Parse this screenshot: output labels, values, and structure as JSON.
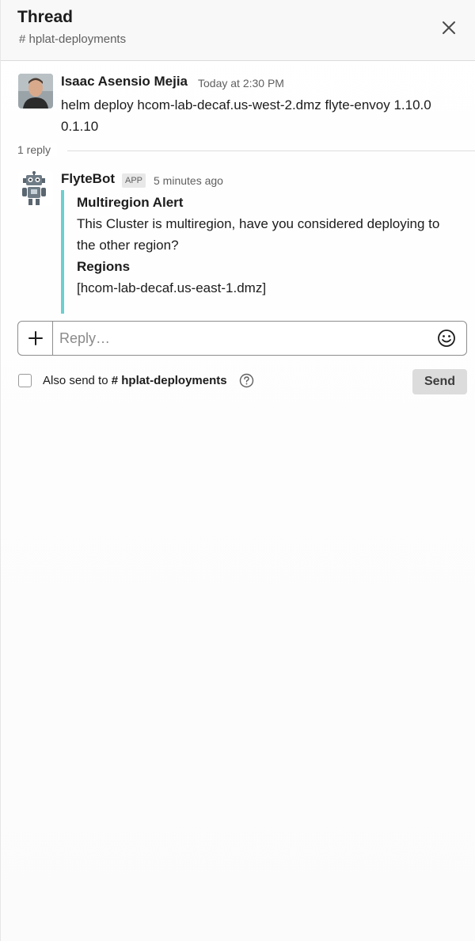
{
  "header": {
    "title": "Thread",
    "channel": "# hplat-deployments"
  },
  "parent_message": {
    "author": "Isaac Asensio Mejia",
    "time": "Today at 2:30 PM",
    "text": "helm deploy hcom-lab-decaf.us-west-2.dmz flyte-envoy 1.10.0 0.1.10"
  },
  "replies": {
    "count_label": "1 reply"
  },
  "reply_message": {
    "author": "FlyteBot",
    "badge": "APP",
    "time": "5 minutes ago",
    "attachment": {
      "accent_color": "#6ecfcf",
      "title": "Multiregion Alert",
      "text": "This Cluster is multiregion, have you considered deploying to the other region?",
      "field_title": "Regions",
      "field_value": "[hcom-lab-decaf.us-east-1.dmz]"
    }
  },
  "composer": {
    "placeholder": "Reply…",
    "plus_icon": "plus-icon",
    "emoji_icon": "smiley-icon"
  },
  "also_send": {
    "label": "Also send to",
    "channel": "# hplat-deployments",
    "checked": false
  },
  "send_label": "Send"
}
